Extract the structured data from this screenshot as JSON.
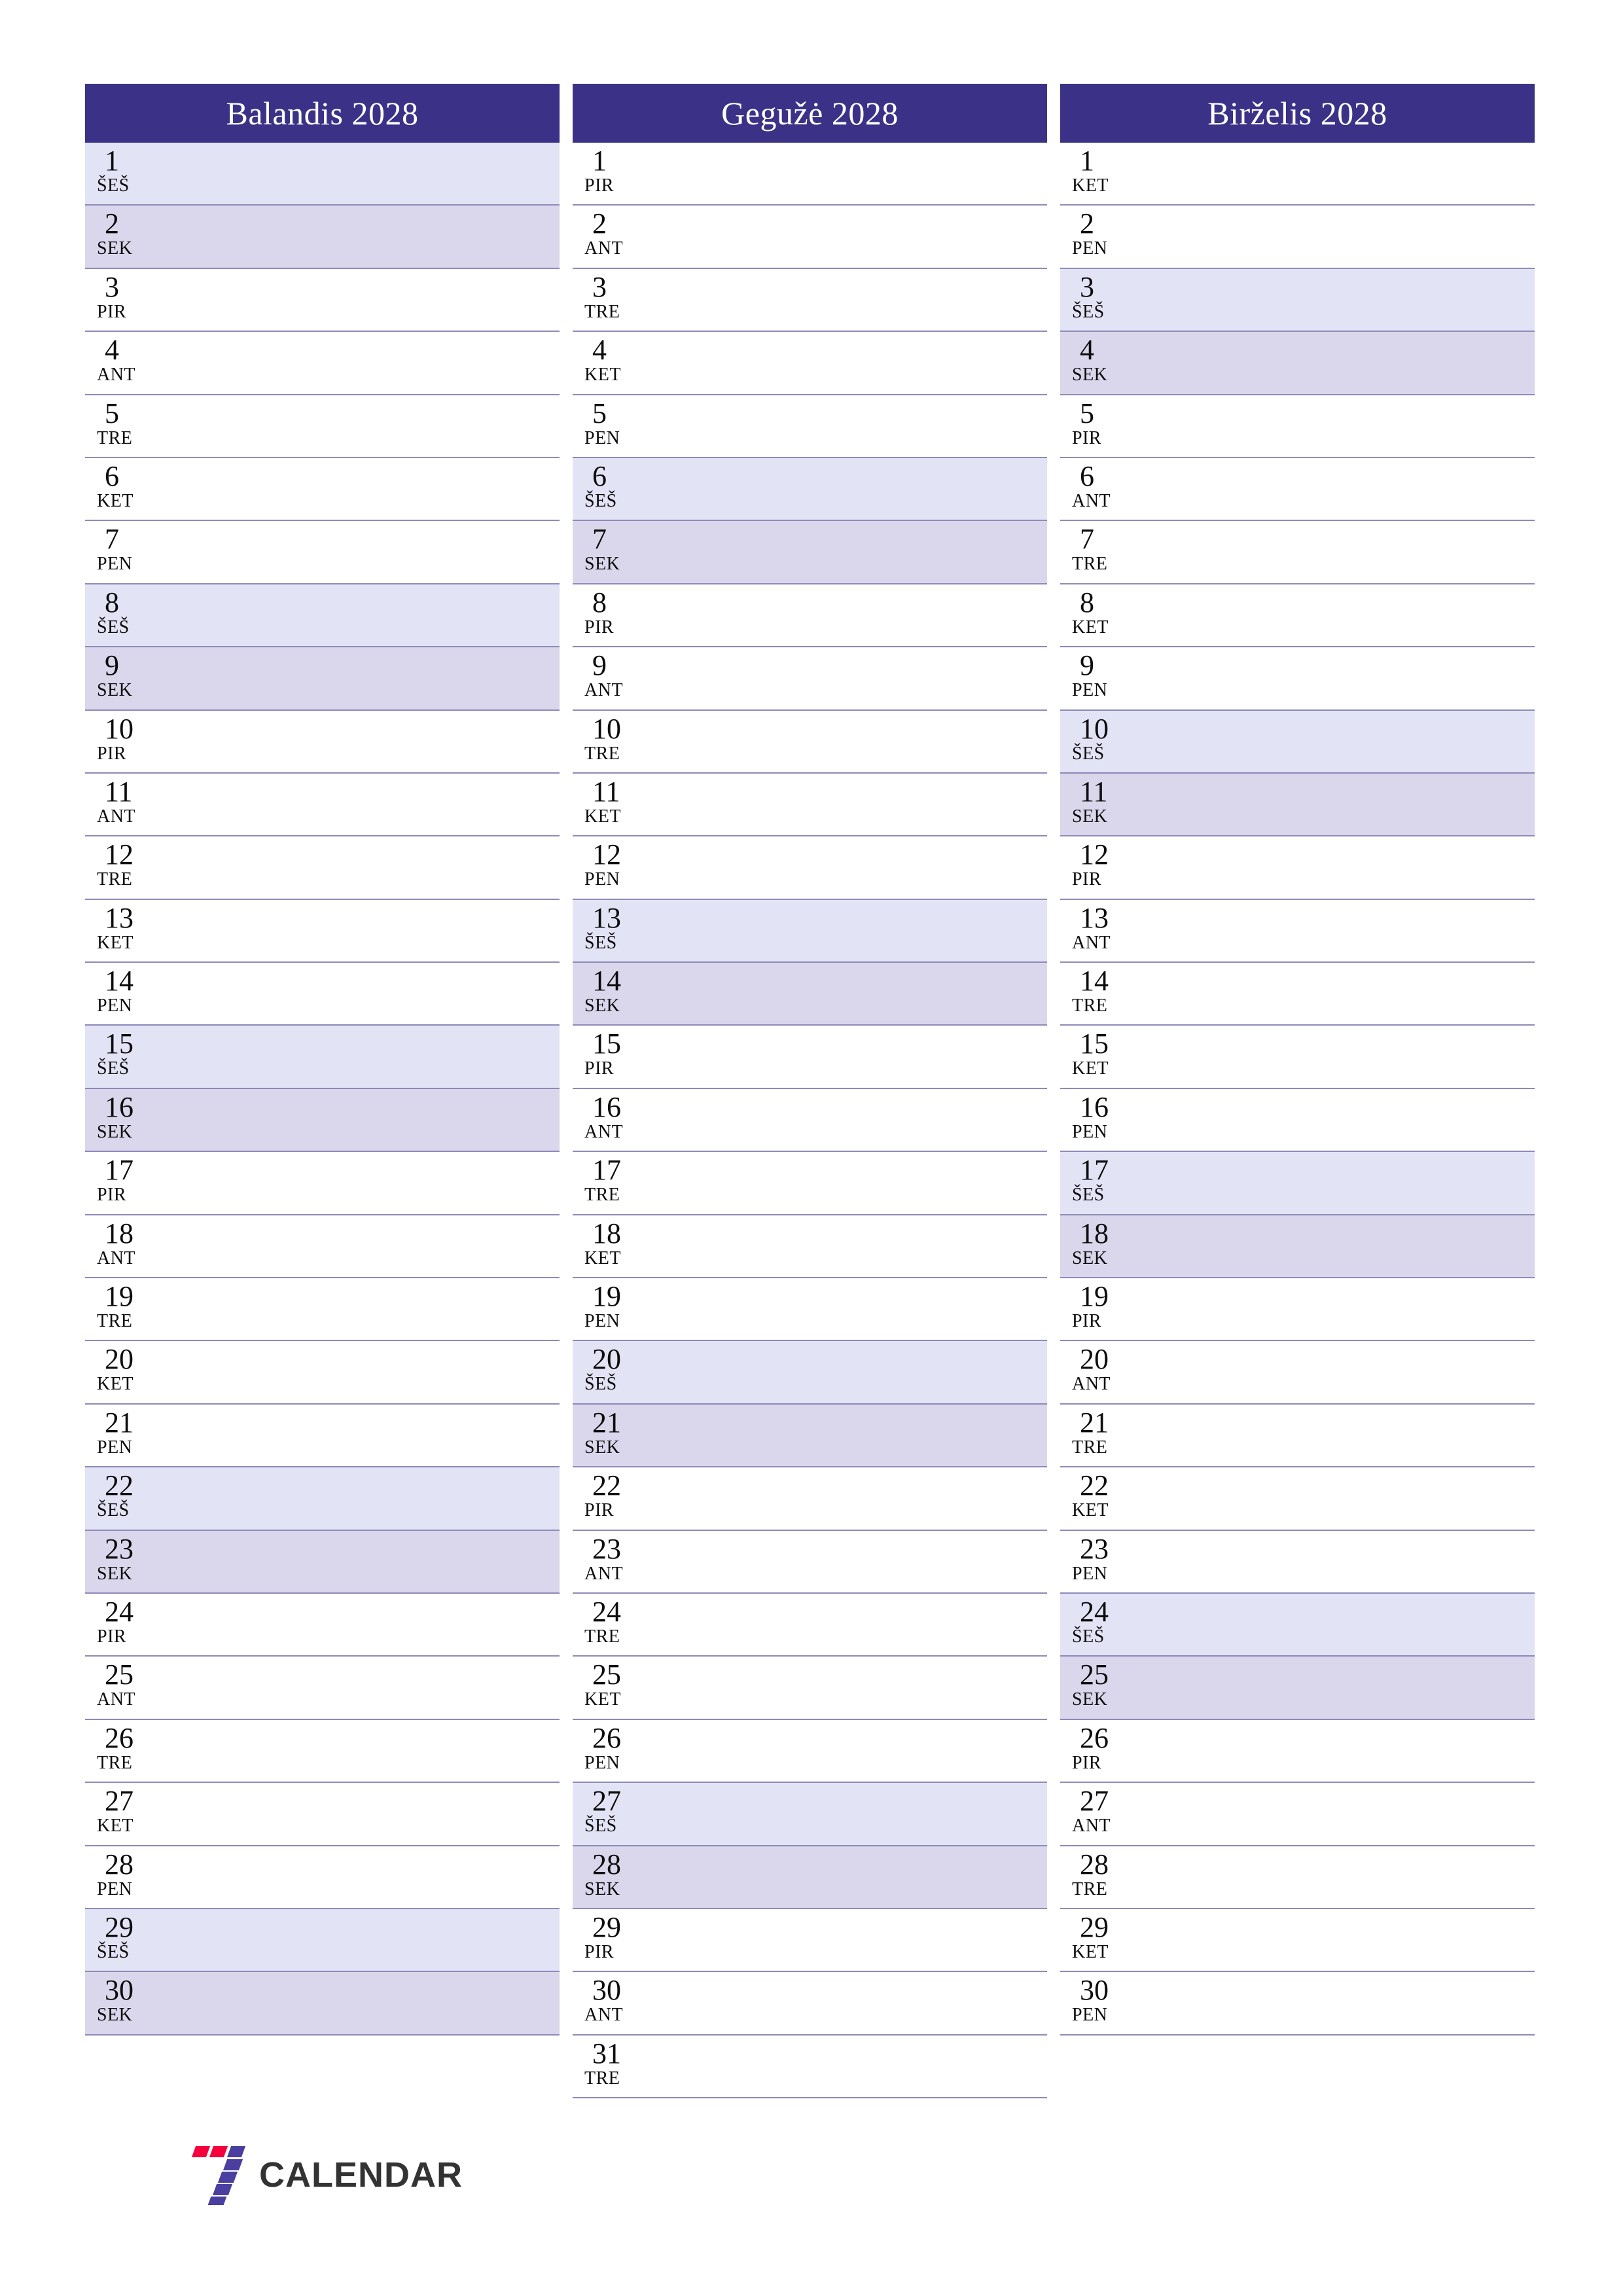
{
  "page": {
    "title": "Balandis – Gegužė – Birželis 2028 planner",
    "accent_color": "#3b3288",
    "saturday_color": "#e3e3f6",
    "sunday_color": "#dad7ec",
    "row_line_color": "#8e8ab9"
  },
  "logo": {
    "mark_name": "seven-calendar-logo",
    "text": "CALENDAR",
    "red": "#f5003c",
    "purple": "#4a3f9e"
  },
  "months": [
    {
      "title": "Balandis 2028",
      "name": "Balandis",
      "year": "2028",
      "days": [
        {
          "num": "1",
          "wd": "ŠEŠ",
          "type": "sat"
        },
        {
          "num": "2",
          "wd": "SEK",
          "type": "sun"
        },
        {
          "num": "3",
          "wd": "PIR",
          "type": "wd"
        },
        {
          "num": "4",
          "wd": "ANT",
          "type": "wd"
        },
        {
          "num": "5",
          "wd": "TRE",
          "type": "wd"
        },
        {
          "num": "6",
          "wd": "KET",
          "type": "wd"
        },
        {
          "num": "7",
          "wd": "PEN",
          "type": "wd"
        },
        {
          "num": "8",
          "wd": "ŠEŠ",
          "type": "sat"
        },
        {
          "num": "9",
          "wd": "SEK",
          "type": "sun"
        },
        {
          "num": "10",
          "wd": "PIR",
          "type": "wd"
        },
        {
          "num": "11",
          "wd": "ANT",
          "type": "wd"
        },
        {
          "num": "12",
          "wd": "TRE",
          "type": "wd"
        },
        {
          "num": "13",
          "wd": "KET",
          "type": "wd"
        },
        {
          "num": "14",
          "wd": "PEN",
          "type": "wd"
        },
        {
          "num": "15",
          "wd": "ŠEŠ",
          "type": "sat"
        },
        {
          "num": "16",
          "wd": "SEK",
          "type": "sun"
        },
        {
          "num": "17",
          "wd": "PIR",
          "type": "wd"
        },
        {
          "num": "18",
          "wd": "ANT",
          "type": "wd"
        },
        {
          "num": "19",
          "wd": "TRE",
          "type": "wd"
        },
        {
          "num": "20",
          "wd": "KET",
          "type": "wd"
        },
        {
          "num": "21",
          "wd": "PEN",
          "type": "wd"
        },
        {
          "num": "22",
          "wd": "ŠEŠ",
          "type": "sat"
        },
        {
          "num": "23",
          "wd": "SEK",
          "type": "sun"
        },
        {
          "num": "24",
          "wd": "PIR",
          "type": "wd"
        },
        {
          "num": "25",
          "wd": "ANT",
          "type": "wd"
        },
        {
          "num": "26",
          "wd": "TRE",
          "type": "wd"
        },
        {
          "num": "27",
          "wd": "KET",
          "type": "wd"
        },
        {
          "num": "28",
          "wd": "PEN",
          "type": "wd"
        },
        {
          "num": "29",
          "wd": "ŠEŠ",
          "type": "sat"
        },
        {
          "num": "30",
          "wd": "SEK",
          "type": "sun"
        }
      ]
    },
    {
      "title": "Gegužė 2028",
      "name": "Gegužė",
      "year": "2028",
      "days": [
        {
          "num": "1",
          "wd": "PIR",
          "type": "wd"
        },
        {
          "num": "2",
          "wd": "ANT",
          "type": "wd"
        },
        {
          "num": "3",
          "wd": "TRE",
          "type": "wd"
        },
        {
          "num": "4",
          "wd": "KET",
          "type": "wd"
        },
        {
          "num": "5",
          "wd": "PEN",
          "type": "wd"
        },
        {
          "num": "6",
          "wd": "ŠEŠ",
          "type": "sat"
        },
        {
          "num": "7",
          "wd": "SEK",
          "type": "sun"
        },
        {
          "num": "8",
          "wd": "PIR",
          "type": "wd"
        },
        {
          "num": "9",
          "wd": "ANT",
          "type": "wd"
        },
        {
          "num": "10",
          "wd": "TRE",
          "type": "wd"
        },
        {
          "num": "11",
          "wd": "KET",
          "type": "wd"
        },
        {
          "num": "12",
          "wd": "PEN",
          "type": "wd"
        },
        {
          "num": "13",
          "wd": "ŠEŠ",
          "type": "sat"
        },
        {
          "num": "14",
          "wd": "SEK",
          "type": "sun"
        },
        {
          "num": "15",
          "wd": "PIR",
          "type": "wd"
        },
        {
          "num": "16",
          "wd": "ANT",
          "type": "wd"
        },
        {
          "num": "17",
          "wd": "TRE",
          "type": "wd"
        },
        {
          "num": "18",
          "wd": "KET",
          "type": "wd"
        },
        {
          "num": "19",
          "wd": "PEN",
          "type": "wd"
        },
        {
          "num": "20",
          "wd": "ŠEŠ",
          "type": "sat"
        },
        {
          "num": "21",
          "wd": "SEK",
          "type": "sun"
        },
        {
          "num": "22",
          "wd": "PIR",
          "type": "wd"
        },
        {
          "num": "23",
          "wd": "ANT",
          "type": "wd"
        },
        {
          "num": "24",
          "wd": "TRE",
          "type": "wd"
        },
        {
          "num": "25",
          "wd": "KET",
          "type": "wd"
        },
        {
          "num": "26",
          "wd": "PEN",
          "type": "wd"
        },
        {
          "num": "27",
          "wd": "ŠEŠ",
          "type": "sat"
        },
        {
          "num": "28",
          "wd": "SEK",
          "type": "sun"
        },
        {
          "num": "29",
          "wd": "PIR",
          "type": "wd"
        },
        {
          "num": "30",
          "wd": "ANT",
          "type": "wd"
        },
        {
          "num": "31",
          "wd": "TRE",
          "type": "wd"
        }
      ]
    },
    {
      "title": "Birželis 2028",
      "name": "Birželis",
      "year": "2028",
      "days": [
        {
          "num": "1",
          "wd": "KET",
          "type": "wd"
        },
        {
          "num": "2",
          "wd": "PEN",
          "type": "wd"
        },
        {
          "num": "3",
          "wd": "ŠEŠ",
          "type": "sat"
        },
        {
          "num": "4",
          "wd": "SEK",
          "type": "sun"
        },
        {
          "num": "5",
          "wd": "PIR",
          "type": "wd"
        },
        {
          "num": "6",
          "wd": "ANT",
          "type": "wd"
        },
        {
          "num": "7",
          "wd": "TRE",
          "type": "wd"
        },
        {
          "num": "8",
          "wd": "KET",
          "type": "wd"
        },
        {
          "num": "9",
          "wd": "PEN",
          "type": "wd"
        },
        {
          "num": "10",
          "wd": "ŠEŠ",
          "type": "sat"
        },
        {
          "num": "11",
          "wd": "SEK",
          "type": "sun"
        },
        {
          "num": "12",
          "wd": "PIR",
          "type": "wd"
        },
        {
          "num": "13",
          "wd": "ANT",
          "type": "wd"
        },
        {
          "num": "14",
          "wd": "TRE",
          "type": "wd"
        },
        {
          "num": "15",
          "wd": "KET",
          "type": "wd"
        },
        {
          "num": "16",
          "wd": "PEN",
          "type": "wd"
        },
        {
          "num": "17",
          "wd": "ŠEŠ",
          "type": "sat"
        },
        {
          "num": "18",
          "wd": "SEK",
          "type": "sun"
        },
        {
          "num": "19",
          "wd": "PIR",
          "type": "wd"
        },
        {
          "num": "20",
          "wd": "ANT",
          "type": "wd"
        },
        {
          "num": "21",
          "wd": "TRE",
          "type": "wd"
        },
        {
          "num": "22",
          "wd": "KET",
          "type": "wd"
        },
        {
          "num": "23",
          "wd": "PEN",
          "type": "wd"
        },
        {
          "num": "24",
          "wd": "ŠEŠ",
          "type": "sat"
        },
        {
          "num": "25",
          "wd": "SEK",
          "type": "sun"
        },
        {
          "num": "26",
          "wd": "PIR",
          "type": "wd"
        },
        {
          "num": "27",
          "wd": "ANT",
          "type": "wd"
        },
        {
          "num": "28",
          "wd": "TRE",
          "type": "wd"
        },
        {
          "num": "29",
          "wd": "KET",
          "type": "wd"
        },
        {
          "num": "30",
          "wd": "PEN",
          "type": "wd"
        }
      ]
    }
  ]
}
